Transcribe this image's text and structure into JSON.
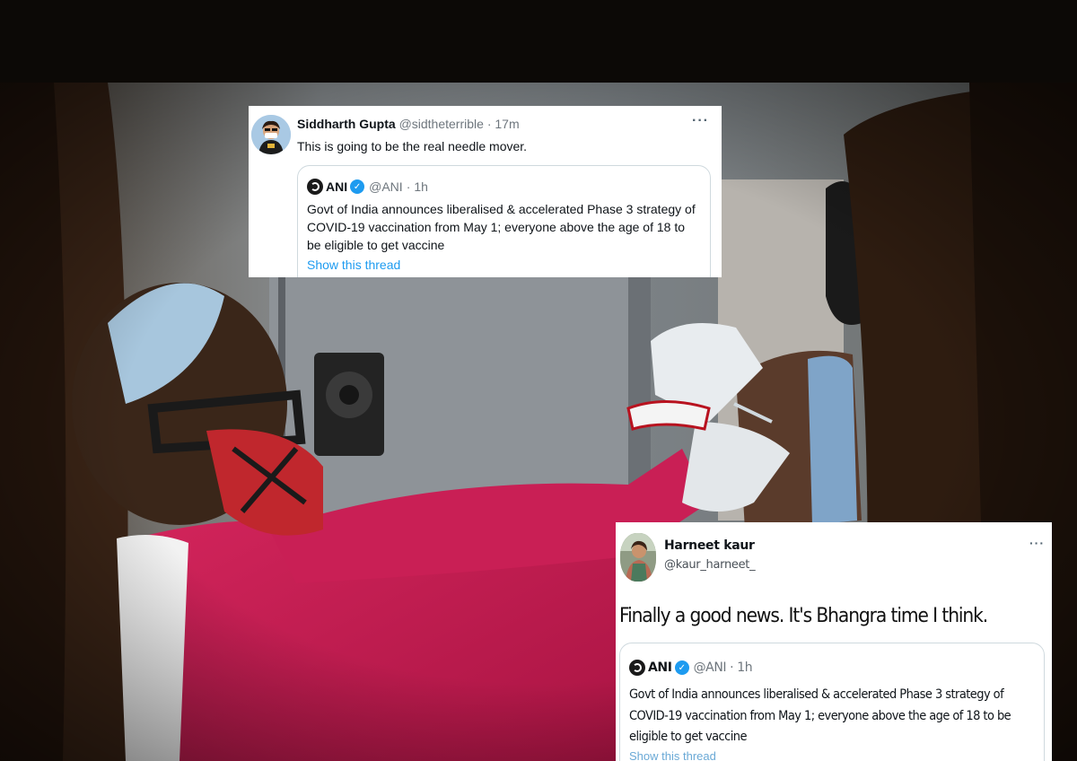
{
  "tweets": [
    {
      "author": {
        "name": "Siddharth Gupta",
        "handle": "@sidtheterrible",
        "time": "17m"
      },
      "menu_icon": "more-options-icon",
      "text": "This is going to be the real needle mover.",
      "quote": {
        "author": {
          "name": "ANI",
          "handle": "@ANI",
          "time": "1h",
          "verified_icon": "verified-badge-icon"
        },
        "text": "Govt of India announces liberalised & accelerated Phase 3 strategy of COVID-19 vaccination from May 1; everyone above the age of 18 to be eligible to get vaccine",
        "link": "Show this thread"
      }
    },
    {
      "author": {
        "name": "Harneet kaur",
        "handle": "@kaur_harneet_"
      },
      "menu_icon": "more-options-icon",
      "text": "Finally a good news. It's Bhangra time I think.",
      "quote": {
        "author": {
          "name": "ANI",
          "handle": "@ANI",
          "time": "1h",
          "verified_icon": "verified-badge-icon"
        },
        "text": "Govt of India announces liberalised & accelerated Phase 3 strategy of COVID-19 vaccination from May 1; everyone above the age of 18 to be eligible to get vaccine",
        "link": "Show this thread"
      }
    }
  ],
  "separator": "·",
  "colors": {
    "link": "#1d9bf0",
    "verified": "#1d9bf0",
    "muted": "#6e767d",
    "scrub_top": "#c8194f"
  }
}
